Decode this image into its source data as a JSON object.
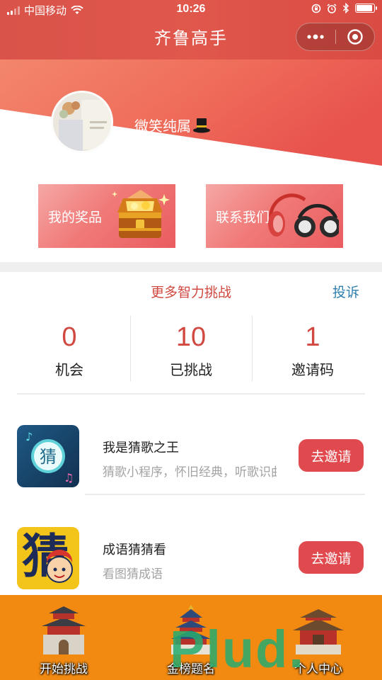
{
  "status_bar": {
    "carrier": "中国移动",
    "time": "10:26"
  },
  "nav": {
    "title": "齐鲁高手"
  },
  "profile": {
    "nickname": "微笑纯属"
  },
  "cards": {
    "prizes_label": "我的奖品",
    "contact_label": "联系我们"
  },
  "challenge": {
    "more_label": "更多智力挑战",
    "complain_label": "投诉"
  },
  "stats": [
    {
      "value": "0",
      "label": "机会"
    },
    {
      "value": "10",
      "label": "已挑战"
    },
    {
      "value": "1",
      "label": "邀请码"
    }
  ],
  "apps": [
    {
      "icon_char": "猜",
      "title": "我是猜歌之王",
      "desc": "猜歌小程序，怀旧经典，听歌识曲",
      "button": "去邀请"
    },
    {
      "icon_char": "猜",
      "title": "成语猜猜看",
      "desc": "看图猜成语",
      "button": "去邀请"
    }
  ],
  "tabbar": [
    {
      "label": "开始挑战"
    },
    {
      "label": "金榜题名"
    },
    {
      "label": "个人中心"
    }
  ],
  "watermark": "Plud.",
  "colors": {
    "primary_red": "#d9534a",
    "accent_red": "#d0483f",
    "link_blue": "#2f7fae",
    "tab_orange": "#f28a12"
  }
}
